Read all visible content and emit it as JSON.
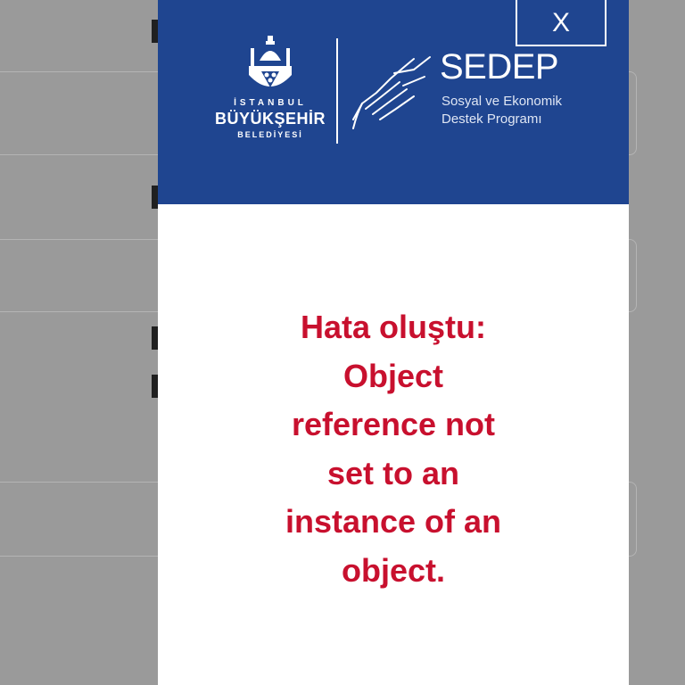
{
  "header": {
    "municipality": {
      "line1": "İSTANBUL",
      "line2": "BÜYÜKŞEHİR",
      "line3": "BELEDİYESİ"
    },
    "program_title": "SEDEP",
    "program_subtitle_line1": "Sosyal ve Ekonomik",
    "program_subtitle_line2": "Destek Programı",
    "close_label": "X"
  },
  "error": {
    "lines": [
      "Hata oluştu:",
      "Object",
      "reference not",
      "set to an",
      "instance of an",
      "object."
    ]
  },
  "colors": {
    "header_bg": "#1f4590",
    "error_text": "#c8102e",
    "overlay": "#9a9a9a"
  },
  "icons": [
    "ibb-emblem-icon",
    "helping-hands-icon"
  ]
}
